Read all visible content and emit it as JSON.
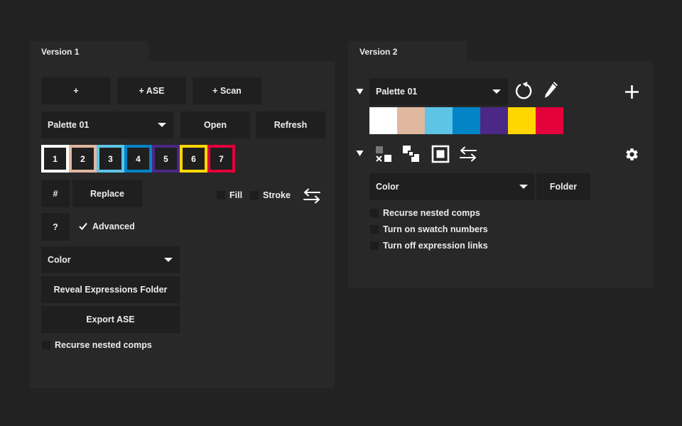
{
  "v1": {
    "tab": "Version 1",
    "buttons": {
      "add": "+",
      "add_ase": "+ ASE",
      "add_scan": "+ Scan",
      "open": "Open",
      "refresh": "Refresh",
      "hash": "#",
      "replace": "Replace",
      "help": "?",
      "reveal": "Reveal Expressions Folder",
      "export": "Export ASE"
    },
    "palette_select": "Palette 01",
    "chips": [
      {
        "label": "1",
        "color": "#FFFFFF"
      },
      {
        "label": "2",
        "color": "#E0B8A0"
      },
      {
        "label": "3",
        "color": "#5EC4E6"
      },
      {
        "label": "4",
        "color": "#0284C7"
      },
      {
        "label": "5",
        "color": "#4B2885"
      },
      {
        "label": "6",
        "color": "#FFD600"
      },
      {
        "label": "7",
        "color": "#E3003B"
      }
    ],
    "fill_label": "Fill",
    "stroke_label": "Stroke",
    "advanced_label": "Advanced",
    "advanced_checked": true,
    "color_select": "Color",
    "recurse_label": "Recurse nested comps"
  },
  "v2": {
    "tab": "Version 2",
    "palette_select": "Palette 01",
    "swatches": [
      "#FFFFFF",
      "#E0B8A0",
      "#5EC4E6",
      "#0284C7",
      "#4B2885",
      "#FFD600",
      "#E3003B"
    ],
    "color_select": "Color",
    "folder_button": "Folder",
    "options": [
      "Recurse nested comps",
      "Turn on swatch numbers",
      "Turn off expression links"
    ]
  }
}
